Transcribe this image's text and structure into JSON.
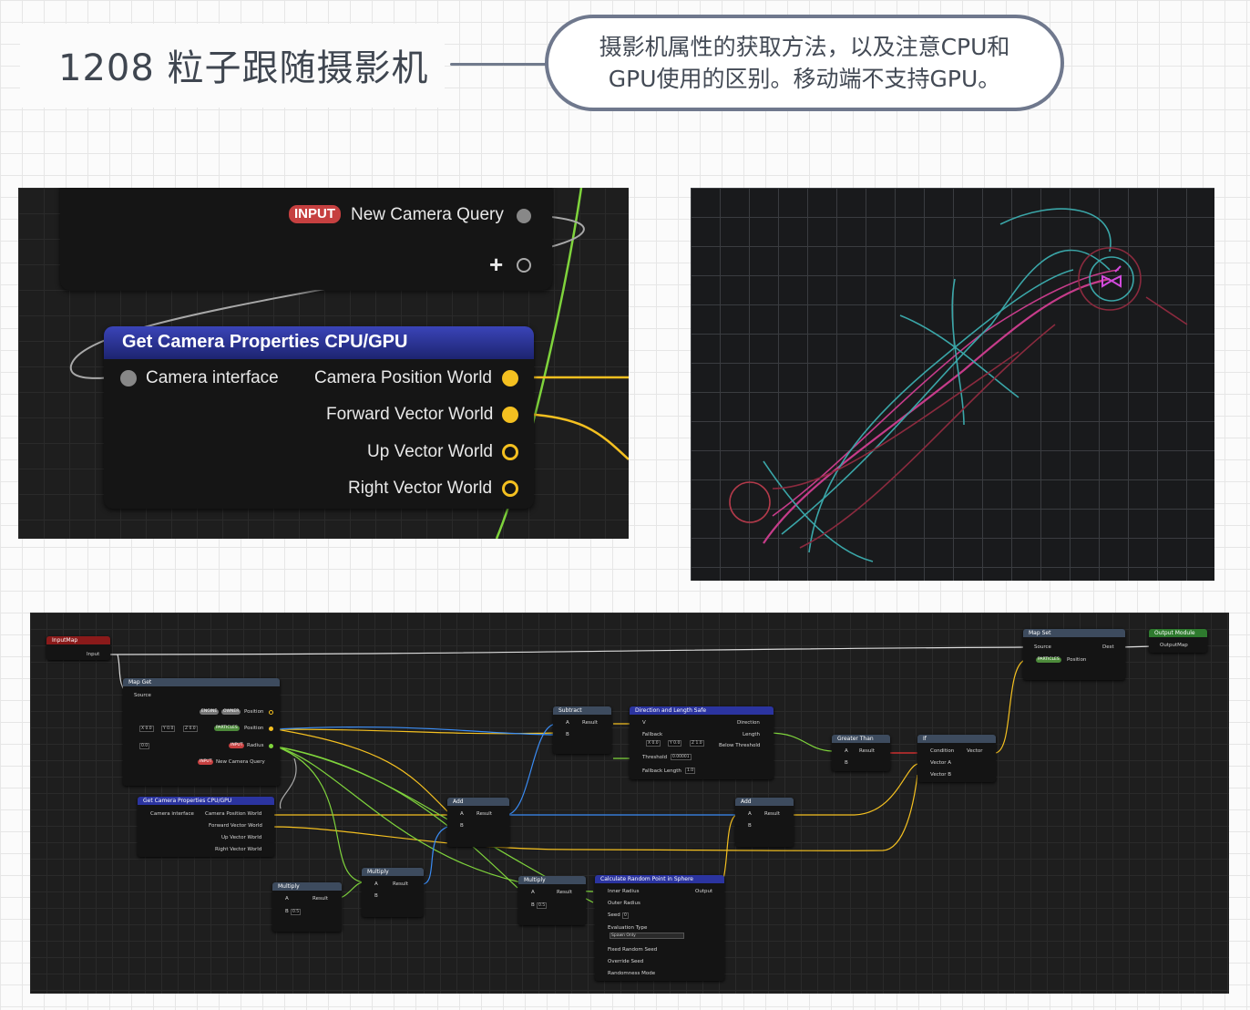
{
  "header": {
    "title": "1208 粒子跟随摄影机",
    "note": "摄影机属性的获取方法，以及注意CPU和GPU使用的区别。移动端不支持GPU。"
  },
  "panel1": {
    "input_badge": "INPUT",
    "query_label": "New Camera Query",
    "node_title": "Get Camera Properties CPU/GPU",
    "camera_interface": "Camera interface",
    "outputs": [
      "Camera Position World",
      "Forward Vector World",
      "Up Vector World",
      "Right Vector World"
    ],
    "colors": {
      "pin_yellow": "#f4c020",
      "header": "#2b34a0",
      "wire_green": "#7fd43c"
    }
  },
  "panel3": {
    "input_map": {
      "title": "InputMap",
      "pin": "Input"
    },
    "map_get": {
      "title": "Map Get",
      "source": "Source",
      "tag_engine": "ENGINE",
      "tag_owner": "OWNER",
      "position": "Position",
      "vec": [
        "X 0.0",
        "Y 0.0",
        "Z 0.0"
      ],
      "tag_particles": "PARTICLES",
      "position2": "Position",
      "val": "0.0",
      "tag_input": "INPUT",
      "radius": "Radius",
      "tag_input2": "INPUT",
      "query": "New Camera Query"
    },
    "camprops": {
      "title": "Get Camera Properties CPU/GPU",
      "iface": "Camera interface",
      "outs": [
        "Camera Position World",
        "Forward Vector World",
        "Up Vector World",
        "Right Vector World"
      ]
    },
    "multiply1": {
      "title": "Multiply",
      "a": "A",
      "b": "B",
      "bval": "0.5",
      "result": "Result"
    },
    "multiply2": {
      "title": "Multiply",
      "a": "A",
      "b": "B",
      "result": "Result"
    },
    "add1": {
      "title": "Add",
      "a": "A",
      "b": "B",
      "result": "Result"
    },
    "subtract": {
      "title": "Subtract",
      "a": "A",
      "b": "B",
      "result": "Result"
    },
    "multiply3": {
      "title": "Multiply",
      "a": "A",
      "b": "B",
      "bval": "0.5",
      "result": "Result"
    },
    "dirlen": {
      "title": "Direction and Length Safe",
      "v": "V",
      "direction": "Direction",
      "fallback": "Fallback",
      "length": "Length",
      "vec": [
        "X 0.0",
        "Y 0.0",
        "Z 1.0"
      ],
      "below": "Below Threshold",
      "threshold": "Threshold",
      "thval": "0.00001",
      "fblen": "Fallback Length",
      "fblenval": "1.0"
    },
    "randpt": {
      "title": "Calculate Random Point in Sphere",
      "inner": "Inner Radius",
      "outer": "Outer Radius",
      "output": "Output",
      "seed": "Seed",
      "seedval": "0",
      "evaltype": "Evaluation Type",
      "spawn": "Spawn Only",
      "fixed": "Fixed Random Seed",
      "override": "Override Seed",
      "randmode": "Randomness Mode"
    },
    "greater": {
      "title": "Greater Than",
      "a": "A",
      "b": "B",
      "result": "Result"
    },
    "add2": {
      "title": "Add",
      "a": "A",
      "b": "B",
      "result": "Result"
    },
    "ifnode": {
      "title": "If",
      "cond": "Condition",
      "va": "Vector A",
      "vb": "Vector B",
      "vector": "Vector"
    },
    "mapset": {
      "title": "Map Set",
      "source": "Source",
      "dest": "Dest",
      "tag": "PARTICLES",
      "position": "Position"
    },
    "output": {
      "title": "Output Module",
      "pin": "OutputMap"
    }
  }
}
